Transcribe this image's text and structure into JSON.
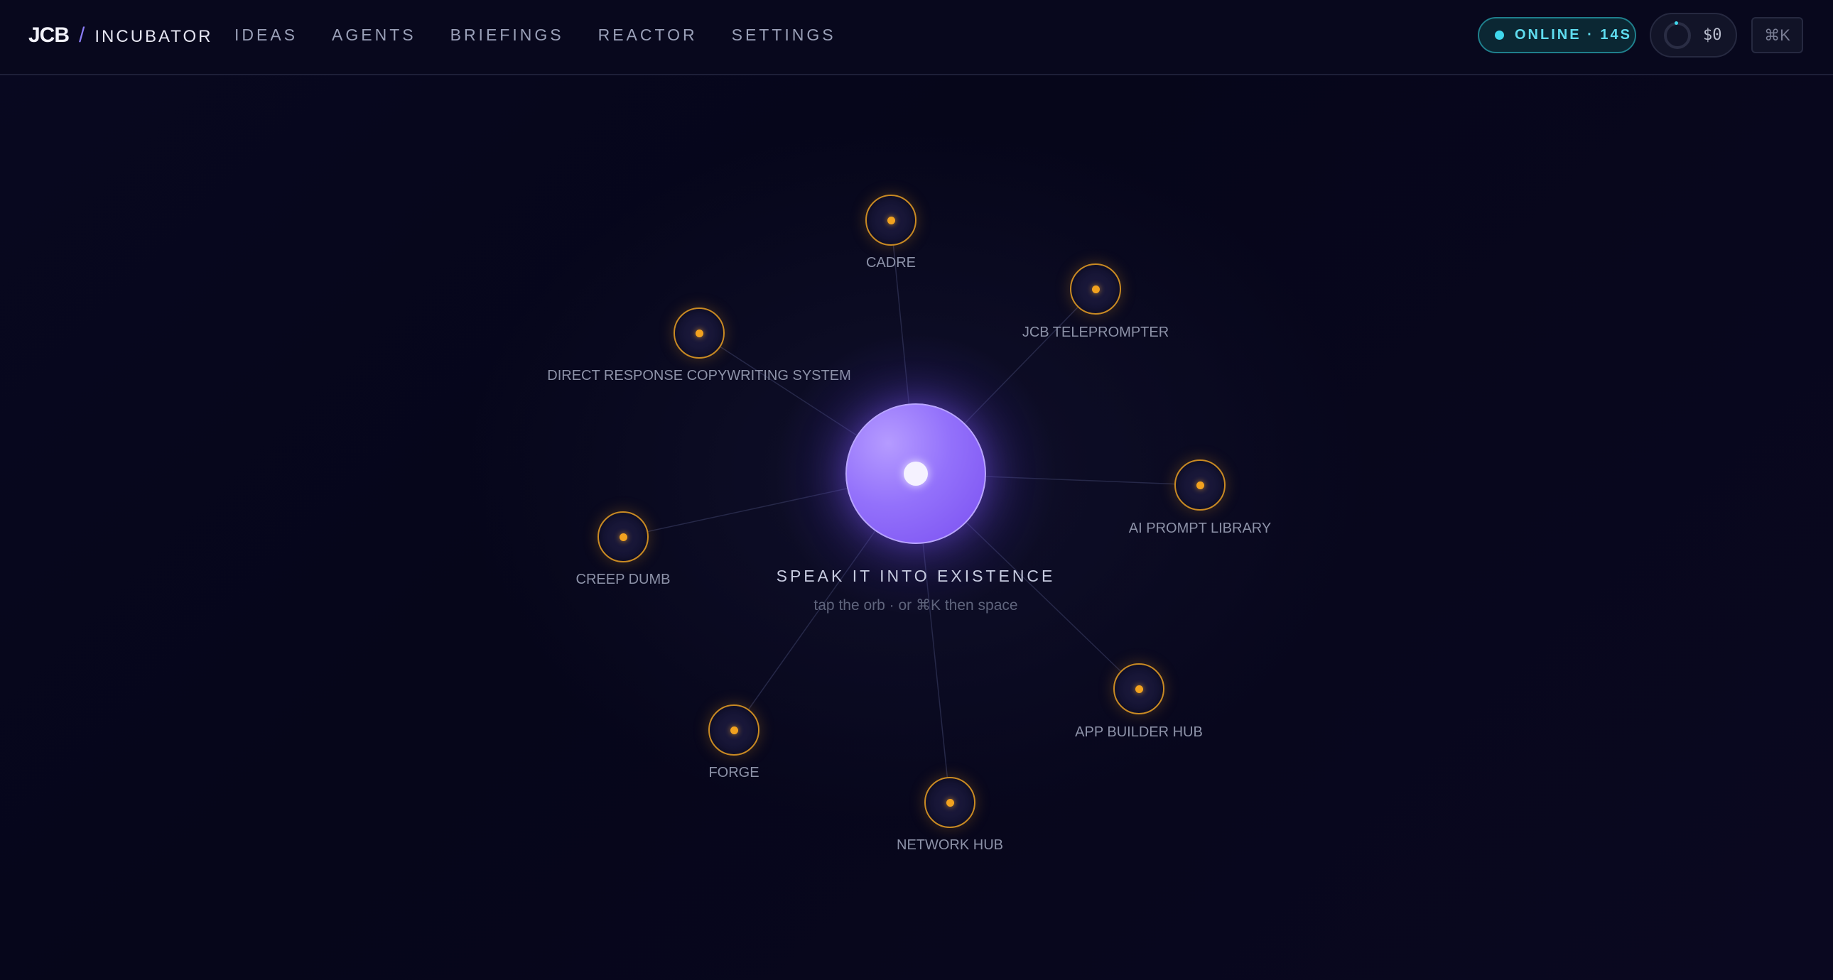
{
  "header": {
    "logo": "JCB",
    "separator": "/",
    "app_name": "INCUBATOR",
    "nav": [
      "IDEAS",
      "AGENTS",
      "BRIEFINGS",
      "REACTOR",
      "SETTINGS"
    ],
    "status": "ONLINE · 14S",
    "cost": "$0",
    "shortcut": "⌘K"
  },
  "orb": {
    "title": "SPEAK IT INTO EXISTENCE",
    "hint": "tap the orb · or ⌘K then space"
  },
  "nodes": [
    "CADRE",
    "JCB TELEPROMPTER",
    "DIRECT RESPONSE COPYWRITING SYSTEM",
    "AI PROMPT LIBRARY",
    "CREEP DUMB",
    "APP BUILDER HUB",
    "FORGE",
    "NETWORK HUB"
  ],
  "colors": {
    "accent": "#8b7cf6",
    "orb": "#8b63f8",
    "node_ring": "#c98a23",
    "node_dot": "#f2a21f",
    "online": "#3fd7ec",
    "background": "#07061a"
  }
}
